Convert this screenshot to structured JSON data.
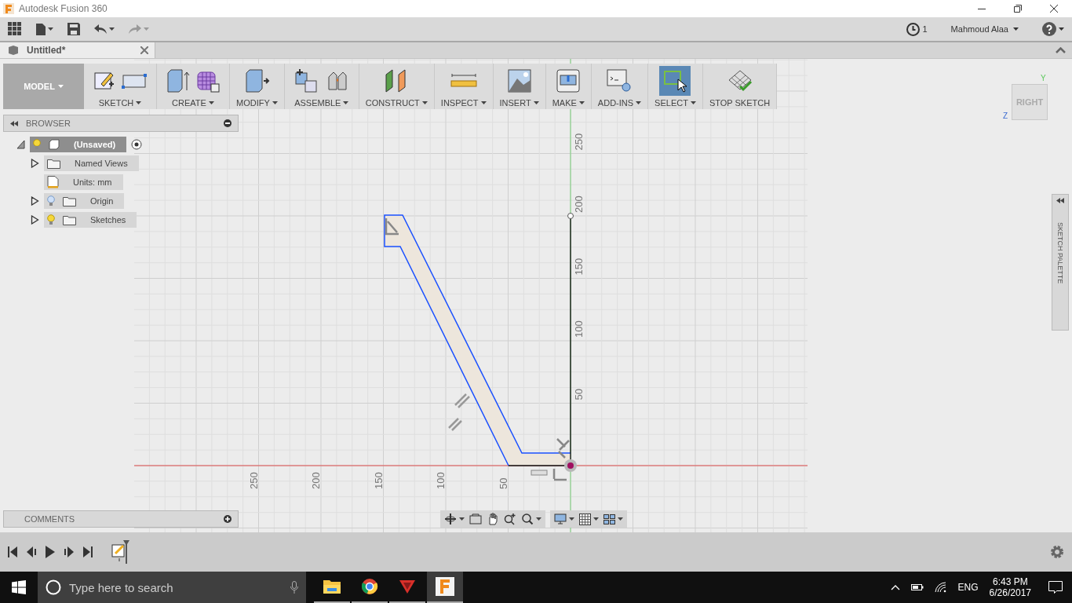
{
  "window": {
    "title": "Autodesk Fusion 360"
  },
  "app_bar": {
    "jobs_count": "1",
    "user": "Mahmoud Alaa"
  },
  "document_tab": {
    "title": "Untitled*"
  },
  "toolbar": {
    "workspace": "MODEL",
    "groups": [
      {
        "label": "SKETCH",
        "selected": false
      },
      {
        "label": "CREATE",
        "selected": false
      },
      {
        "label": "MODIFY",
        "selected": false
      },
      {
        "label": "ASSEMBLE",
        "selected": false
      },
      {
        "label": "CONSTRUCT",
        "selected": false
      },
      {
        "label": "INSPECT",
        "selected": false
      },
      {
        "label": "INSERT",
        "selected": false
      },
      {
        "label": "MAKE",
        "selected": false
      },
      {
        "label": "ADD-INS",
        "selected": false
      },
      {
        "label": "SELECT",
        "selected": true
      }
    ],
    "finish": "STOP SKETCH"
  },
  "browser": {
    "title": "BROWSER",
    "root": {
      "label": "(Unsaved)",
      "expanded": true,
      "visible": true,
      "children": [
        {
          "label": "Named Views",
          "kind": "folder",
          "expanded": false
        },
        {
          "label": "Units: mm",
          "kind": "units"
        },
        {
          "label": "Origin",
          "kind": "folder",
          "expanded": false,
          "visible": false
        },
        {
          "label": "Sketches",
          "kind": "folder",
          "expanded": false,
          "visible": true
        }
      ]
    }
  },
  "viewport": {
    "vertical_ruler": [
      "250",
      "200",
      "150",
      "100",
      "50"
    ],
    "horizontal_ruler": [
      "250",
      "200",
      "150",
      "100",
      "50"
    ]
  },
  "view_cube": {
    "face": "RIGHT",
    "axes": [
      "Y",
      "Z"
    ]
  },
  "sketch_palette": {
    "title": "SKETCH PALETTE"
  },
  "comments": {
    "title": "COMMENTS"
  },
  "taskbar": {
    "search_placeholder": "Type here to search",
    "apps": [
      {
        "kind": "folder",
        "selected": false
      },
      {
        "kind": "browser",
        "selected": false
      },
      {
        "kind": "triangle",
        "selected": false
      },
      {
        "kind": "letter",
        "selected": true
      }
    ],
    "language": "ENG",
    "time": "6:43 PM",
    "date": "6/26/2017"
  }
}
